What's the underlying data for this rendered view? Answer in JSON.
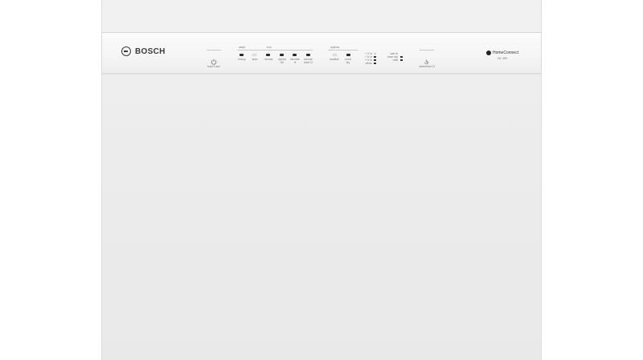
{
  "brand": {
    "name": "BOSCH",
    "logo_icon": "bosch-logo-icon"
  },
  "power": {
    "label": "hold 3 sec",
    "icon": "power-icon"
  },
  "headers": {
    "wash": "wash",
    "eco": "eco",
    "options": "options"
  },
  "programs": [
    {
      "label": "heavy"
    },
    {
      "label": "auto"
    },
    {
      "label": "normal"
    },
    {
      "label": "speed 60"
    },
    {
      "label": "favorite ♥"
    },
    {
      "label": "remote start ⊡"
    }
  ],
  "options": [
    {
      "label": "sanitize"
    },
    {
      "label": "extra dry"
    }
  ],
  "delay": [
    "+ 3 hr",
    "+ 6 hr",
    "+ 9 hr",
    "clean"
  ],
  "status": [
    "salt ⊕",
    "rinse aid",
    "refill"
  ],
  "start": {
    "label": "start/reset ⊡",
    "icon": "start-touch-icon"
  },
  "home_connect": {
    "name": "HomeConnect",
    "sub": "DE 4KE",
    "icon": "home-connect-icon"
  },
  "colors": {
    "panel": "#f7f7f7",
    "door": "#ececec",
    "led": "#2a2a2a",
    "text": "#3a3a3a"
  }
}
